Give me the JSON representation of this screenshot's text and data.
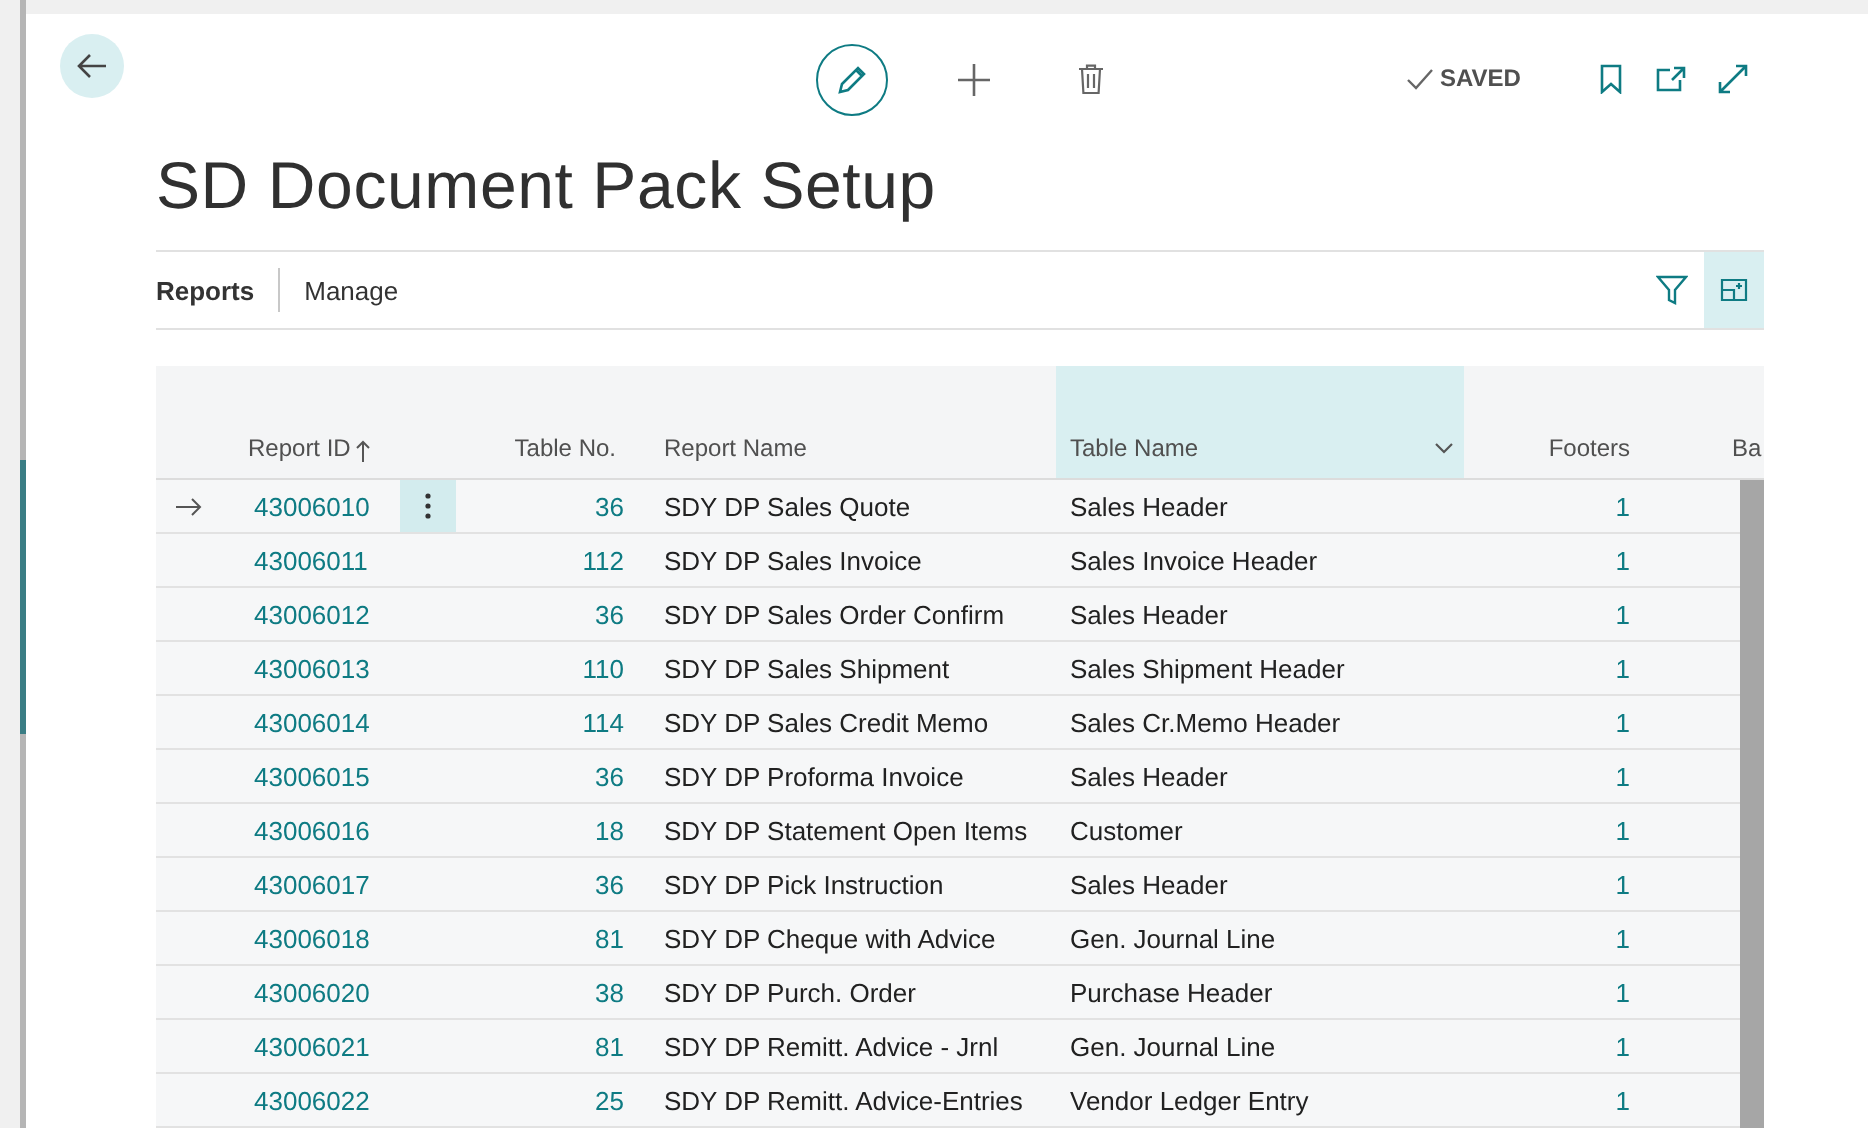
{
  "toolbar": {
    "saved": "SAVED"
  },
  "title": "SD Document Pack Setup",
  "actions": [
    {
      "label": "Reports",
      "selected": true
    },
    {
      "label": "Manage",
      "selected": false
    }
  ],
  "table": {
    "columns": [
      {
        "label": "Report ID",
        "sorted": true,
        "selected": false
      },
      {
        "label": "Table No.",
        "sorted": false,
        "selected": false
      },
      {
        "label": "Report Name",
        "sorted": false,
        "selected": false
      },
      {
        "label": "Table Name",
        "sorted": false,
        "selected": true
      },
      {
        "label": "Footers",
        "sorted": false,
        "selected": false
      },
      {
        "label": "Ba",
        "sorted": false,
        "selected": false
      }
    ],
    "rows": [
      {
        "selected": true,
        "report_id": "43006010",
        "table_no": "36",
        "report_name": "SDY DP Sales Quote",
        "table_name": "Sales Header",
        "footers": "1"
      },
      {
        "selected": false,
        "report_id": "43006011",
        "table_no": "112",
        "report_name": "SDY DP Sales Invoice",
        "table_name": "Sales Invoice Header",
        "footers": "1"
      },
      {
        "selected": false,
        "report_id": "43006012",
        "table_no": "36",
        "report_name": "SDY DP Sales Order Confirm",
        "table_name": "Sales Header",
        "footers": "1"
      },
      {
        "selected": false,
        "report_id": "43006013",
        "table_no": "110",
        "report_name": "SDY DP Sales Shipment",
        "table_name": "Sales Shipment Header",
        "footers": "1"
      },
      {
        "selected": false,
        "report_id": "43006014",
        "table_no": "114",
        "report_name": "SDY DP Sales Credit Memo",
        "table_name": "Sales Cr.Memo Header",
        "footers": "1"
      },
      {
        "selected": false,
        "report_id": "43006015",
        "table_no": "36",
        "report_name": "SDY DP Proforma Invoice",
        "table_name": "Sales Header",
        "footers": "1"
      },
      {
        "selected": false,
        "report_id": "43006016",
        "table_no": "18",
        "report_name": "SDY DP Statement Open Items",
        "table_name": "Customer",
        "footers": "1"
      },
      {
        "selected": false,
        "report_id": "43006017",
        "table_no": "36",
        "report_name": "SDY DP Pick Instruction",
        "table_name": "Sales Header",
        "footers": "1"
      },
      {
        "selected": false,
        "report_id": "43006018",
        "table_no": "81",
        "report_name": "SDY DP Cheque with Advice",
        "table_name": "Gen. Journal Line",
        "footers": "1"
      },
      {
        "selected": false,
        "report_id": "43006020",
        "table_no": "38",
        "report_name": "SDY DP Purch. Order",
        "table_name": "Purchase Header",
        "footers": "1"
      },
      {
        "selected": false,
        "report_id": "43006021",
        "table_no": "81",
        "report_name": "SDY DP Remitt. Advice - Jrnl",
        "table_name": "Gen. Journal Line",
        "footers": "1"
      },
      {
        "selected": false,
        "report_id": "43006022",
        "table_no": "25",
        "report_name": "SDY DP Remitt. Advice-Entries",
        "table_name": "Vendor Ledger Entry",
        "footers": "1"
      }
    ]
  }
}
